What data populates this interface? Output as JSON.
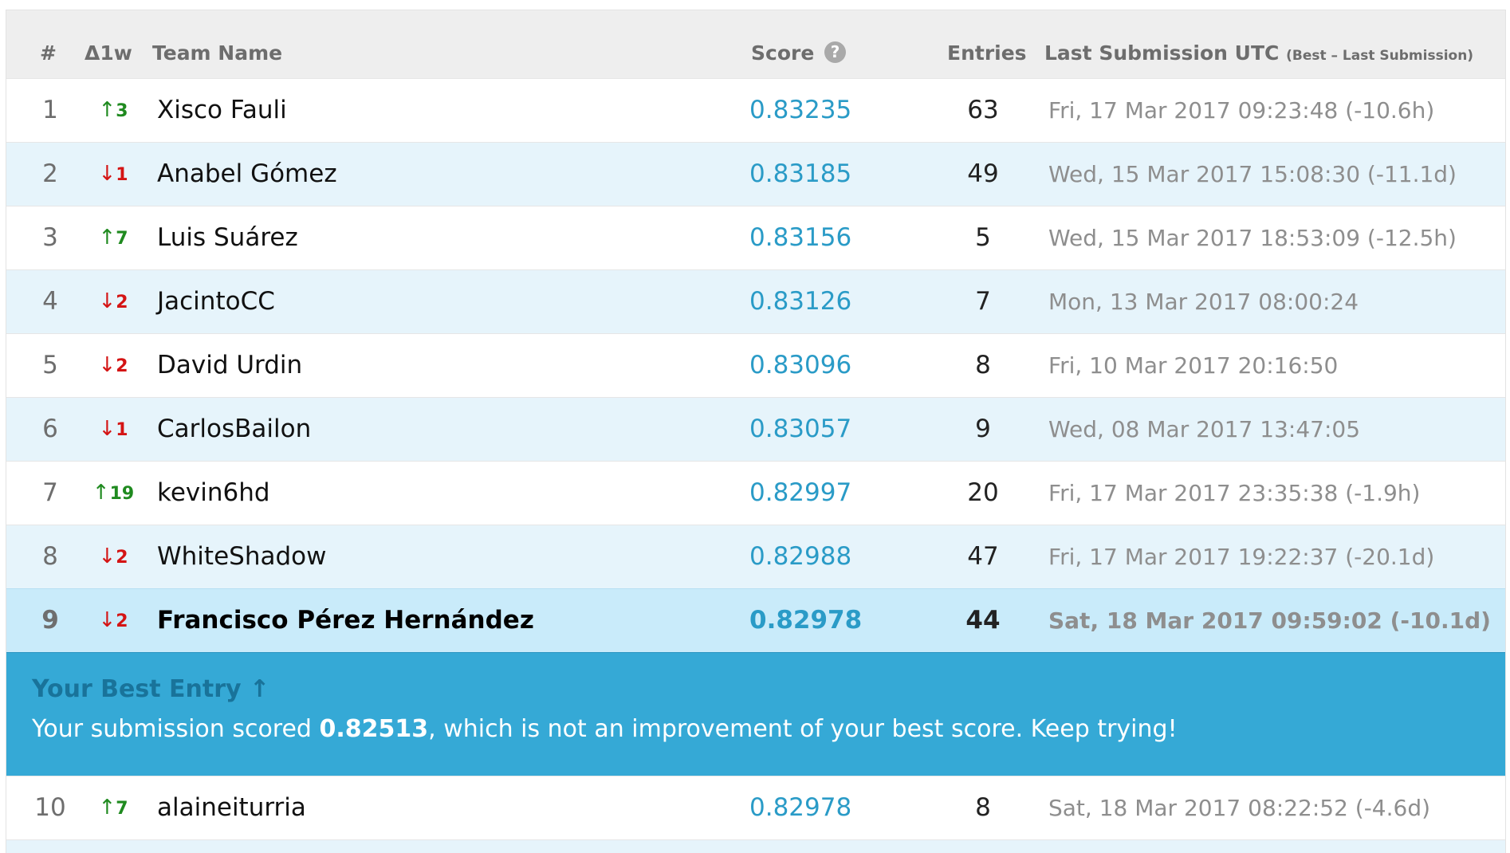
{
  "header": {
    "rank": "#",
    "delta": "Δ1w",
    "team": "Team Name",
    "score": "Score",
    "help": "?",
    "entries": "Entries",
    "last": "Last Submission UTC",
    "last_sub": "(Best – Last Submission)"
  },
  "rows": [
    {
      "rank": "1",
      "dir": "up",
      "arrow": "↑",
      "delta": "3",
      "team": "Xisco Fauli",
      "score": "0.83235",
      "entries": "63",
      "last": "Fri, 17 Mar 2017 09:23:48 (-10.6h)"
    },
    {
      "rank": "2",
      "dir": "down",
      "arrow": "↓",
      "delta": "1",
      "team": "Anabel Gómez",
      "score": "0.83185",
      "entries": "49",
      "last": "Wed, 15 Mar 2017 15:08:30 (-11.1d)"
    },
    {
      "rank": "3",
      "dir": "up",
      "arrow": "↑",
      "delta": "7",
      "team": "Luis Suárez",
      "score": "0.83156",
      "entries": "5",
      "last": "Wed, 15 Mar 2017 18:53:09 (-12.5h)"
    },
    {
      "rank": "4",
      "dir": "down",
      "arrow": "↓",
      "delta": "2",
      "team": "JacintoCC",
      "score": "0.83126",
      "entries": "7",
      "last": "Mon, 13 Mar 2017 08:00:24"
    },
    {
      "rank": "5",
      "dir": "down",
      "arrow": "↓",
      "delta": "2",
      "team": "David Urdin",
      "score": "0.83096",
      "entries": "8",
      "last": "Fri, 10 Mar 2017 20:16:50"
    },
    {
      "rank": "6",
      "dir": "down",
      "arrow": "↓",
      "delta": "1",
      "team": "CarlosBailon",
      "score": "0.83057",
      "entries": "9",
      "last": "Wed, 08 Mar 2017 13:47:05"
    },
    {
      "rank": "7",
      "dir": "up",
      "arrow": "↑",
      "delta": "19",
      "team": "kevin6hd",
      "score": "0.82997",
      "entries": "20",
      "last": "Fri, 17 Mar 2017 23:35:38 (-1.9h)"
    },
    {
      "rank": "8",
      "dir": "down",
      "arrow": "↓",
      "delta": "2",
      "team": "WhiteShadow",
      "score": "0.82988",
      "entries": "47",
      "last": "Fri, 17 Mar 2017 19:22:37 (-20.1d)"
    },
    {
      "rank": "9",
      "dir": "down",
      "arrow": "↓",
      "delta": "2",
      "team": "Francisco Pérez Hernández",
      "score": "0.82978",
      "entries": "44",
      "last": "Sat, 18 Mar 2017 09:59:02 (-10.1d)"
    },
    {
      "rank": "10",
      "dir": "up",
      "arrow": "↑",
      "delta": "7",
      "team": "alaineiturria",
      "score": "0.82978",
      "entries": "8",
      "last": "Sat, 18 Mar 2017 08:22:52 (-4.6d)"
    }
  ],
  "best_entry": {
    "title": "Your Best Entry ↑",
    "msg_prefix": "Your submission scored ",
    "msg_score": "0.82513",
    "msg_suffix": ", which is not an improvement of your best score. Keep trying!"
  },
  "colors": {
    "up": "#1f8a1f",
    "down": "#d41414",
    "score": "#2a9bc7",
    "highlight_row": "#c9ebfa",
    "banner": "#35a9d6"
  }
}
